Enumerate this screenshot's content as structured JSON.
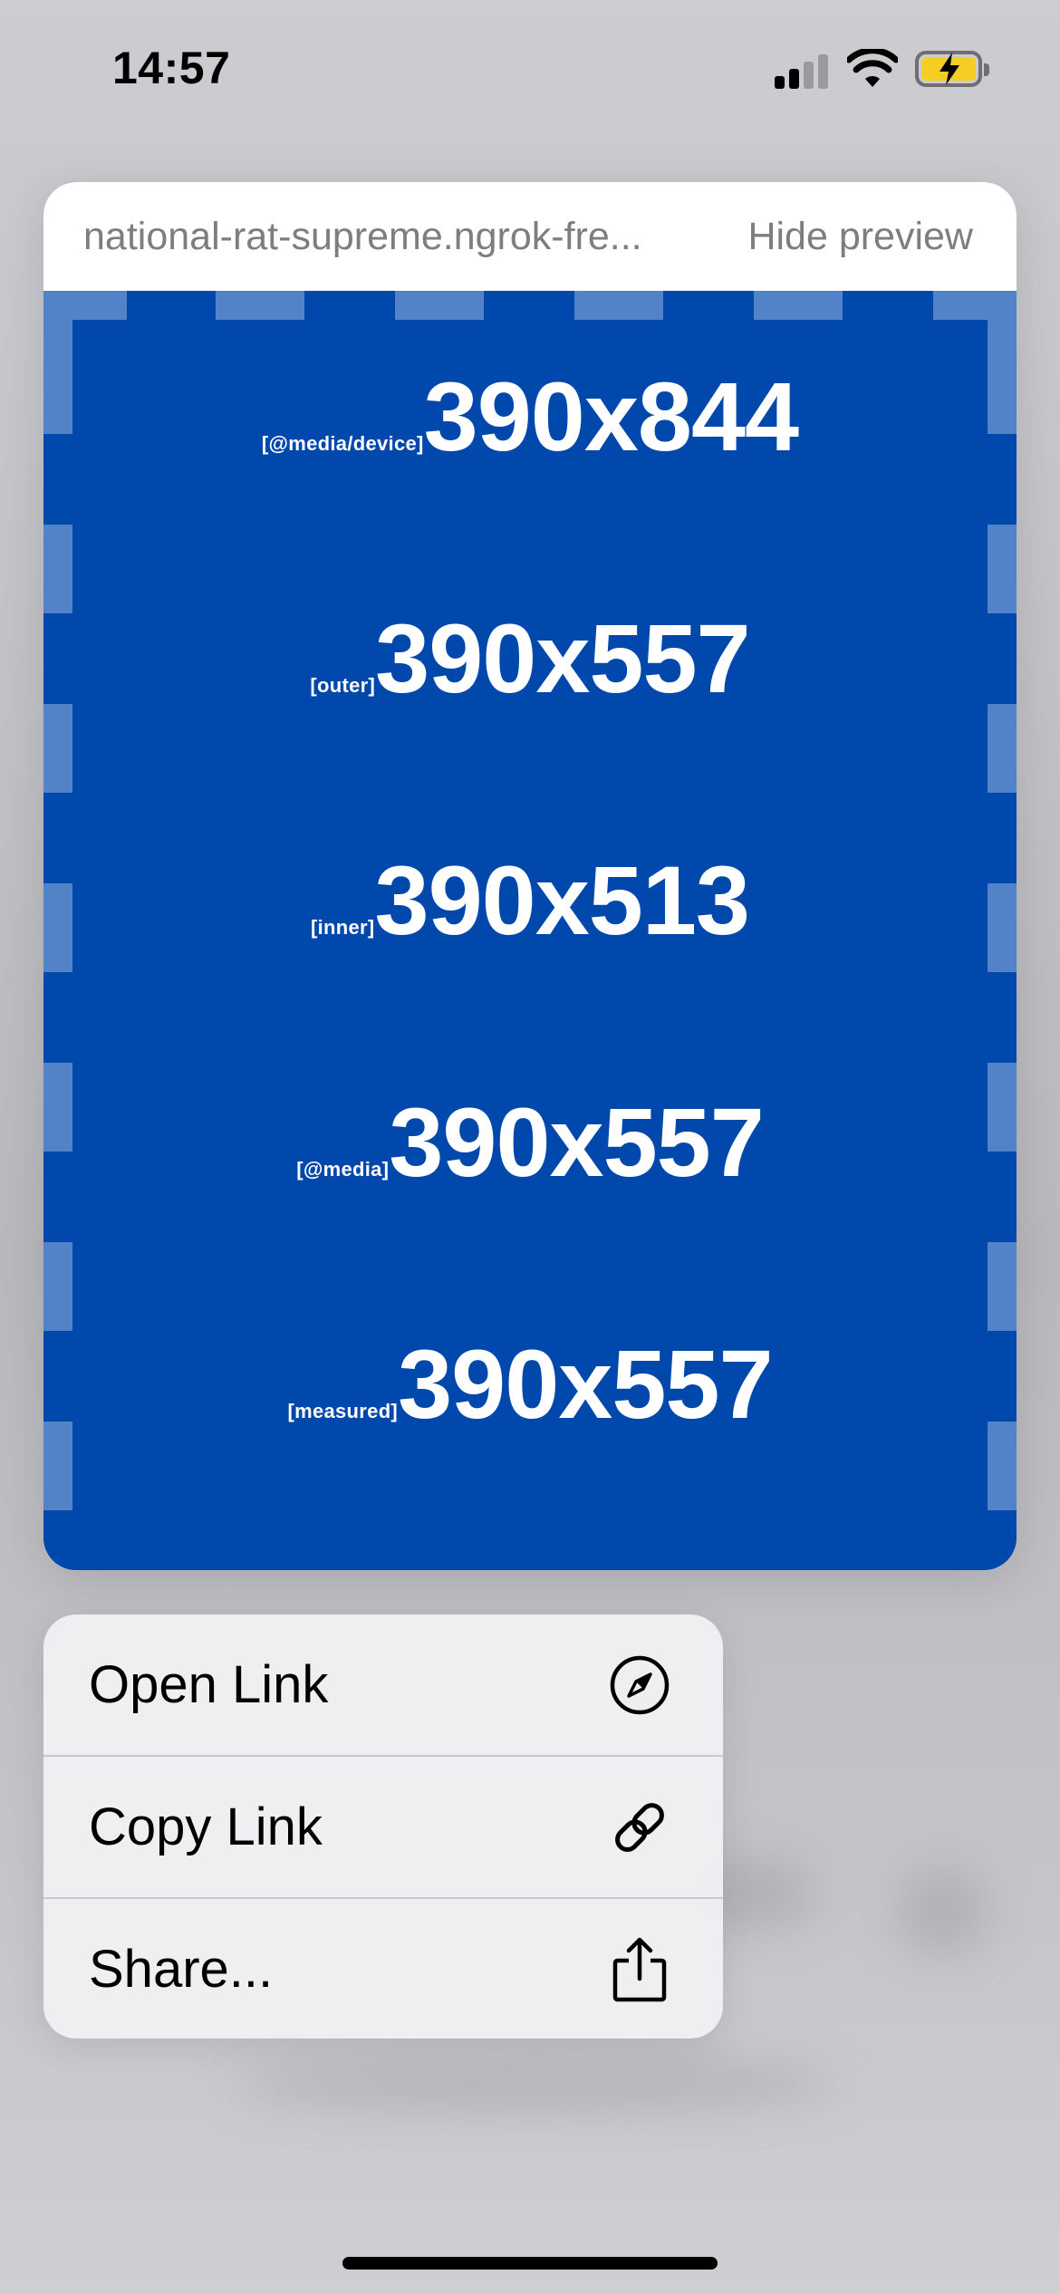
{
  "status_bar": {
    "time": "14:57",
    "battery_color": "#f6cd22",
    "icons": [
      "cellular-signal-icon",
      "wifi-icon",
      "battery-charging-icon"
    ]
  },
  "preview": {
    "url": "national-rat-supreme.ngrok-fre...",
    "hide_label": "Hide preview",
    "background_color": "#0048ab",
    "dash_color": "#5283c8",
    "rows": [
      {
        "tag": "[@media/device]",
        "value": "390x844"
      },
      {
        "tag": "[outer]",
        "value": "390x557"
      },
      {
        "tag": "[inner]",
        "value": "390x513"
      },
      {
        "tag": "[@media]",
        "value": "390x557"
      },
      {
        "tag": "[measured]",
        "value": "390x557"
      }
    ]
  },
  "menu": {
    "items": [
      {
        "label": "Open Link",
        "icon": "compass-icon"
      },
      {
        "label": "Copy Link",
        "icon": "link-icon"
      },
      {
        "label": "Share...",
        "icon": "share-icon"
      }
    ]
  }
}
